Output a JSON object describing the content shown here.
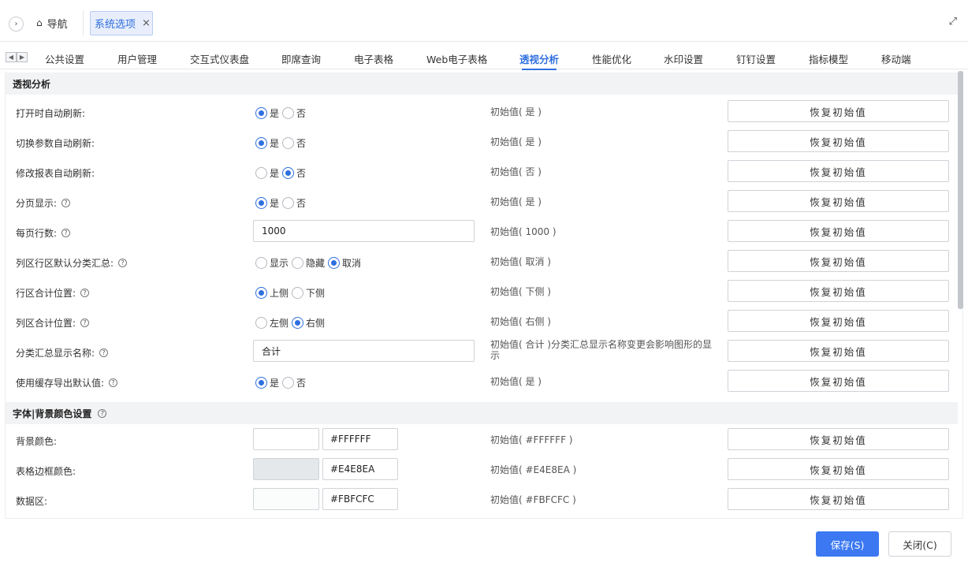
{
  "header": {
    "nav_label": "导航",
    "open_tab_label": "系统选项",
    "close_symbol": "×"
  },
  "tabs": [
    {
      "label": "公共设置"
    },
    {
      "label": "用户管理"
    },
    {
      "label": "交互式仪表盘"
    },
    {
      "label": "即席查询"
    },
    {
      "label": "电子表格"
    },
    {
      "label": "Web电子表格"
    },
    {
      "label": "透视分析",
      "active": true
    },
    {
      "label": "性能优化"
    },
    {
      "label": "水印设置"
    },
    {
      "label": "钉钉设置"
    },
    {
      "label": "指标模型"
    },
    {
      "label": "移动端"
    }
  ],
  "section1": {
    "title": "透视分析",
    "rows": [
      {
        "label": "打开时自动刷新:",
        "options": [
          "是",
          "否"
        ],
        "selected": 0,
        "initial": "初始值( 是 )"
      },
      {
        "label": "切换参数自动刷新:",
        "options": [
          "是",
          "否"
        ],
        "selected": 0,
        "initial": "初始值( 是 )"
      },
      {
        "label": "修改报表自动刷新:",
        "options": [
          "是",
          "否"
        ],
        "selected": 1,
        "initial": "初始值( 否 )"
      },
      {
        "label": "分页显示:",
        "options": [
          "是",
          "否"
        ],
        "selected": 0,
        "initial": "初始值( 是 )"
      },
      {
        "label": "每页行数:",
        "value": "1000",
        "initial": "初始值( 1000 )"
      },
      {
        "label": "列区行区默认分类汇总:",
        "options": [
          "显示",
          "隐藏",
          "取消"
        ],
        "selected": 2,
        "initial": "初始值( 取消 )"
      },
      {
        "label": "行区合计位置:",
        "options": [
          "上侧",
          "下侧"
        ],
        "selected": 0,
        "initial": "初始值( 下侧 )"
      },
      {
        "label": "列区合计位置:",
        "options": [
          "左侧",
          "右侧"
        ],
        "selected": 1,
        "initial": "初始值( 右侧 )"
      },
      {
        "label": "分类汇总显示名称:",
        "value": "合计",
        "initial": "初始值( 合计 )分类汇总显示名称变更会影响图形的显示"
      },
      {
        "label": "使用缓存导出默认值:",
        "options": [
          "是",
          "否"
        ],
        "selected": 0,
        "initial": "初始值( 是 )"
      }
    ]
  },
  "section2": {
    "title": "字体|背景颜色设置",
    "rows": [
      {
        "label": "背景颜色:",
        "color": "#FFFFFF",
        "value": "#FFFFFF",
        "initial": "初始值( #FFFFFF )"
      },
      {
        "label": "表格边框颜色:",
        "color": "#E4E8EA",
        "value": "#E4E8EA",
        "initial": "初始值( #E4E8EA )"
      },
      {
        "label": "数据区:",
        "color": "#FBFCFC",
        "value": "#FBFCFC",
        "initial": "初始值( #FBFCFC )"
      }
    ]
  },
  "reset_label": "恢复初始值",
  "footer": {
    "save_label": "保存(S)",
    "close_label": "关闭(C)"
  },
  "colors": {
    "accent": "#2f6fde",
    "primary_button": "#3b78f1"
  }
}
